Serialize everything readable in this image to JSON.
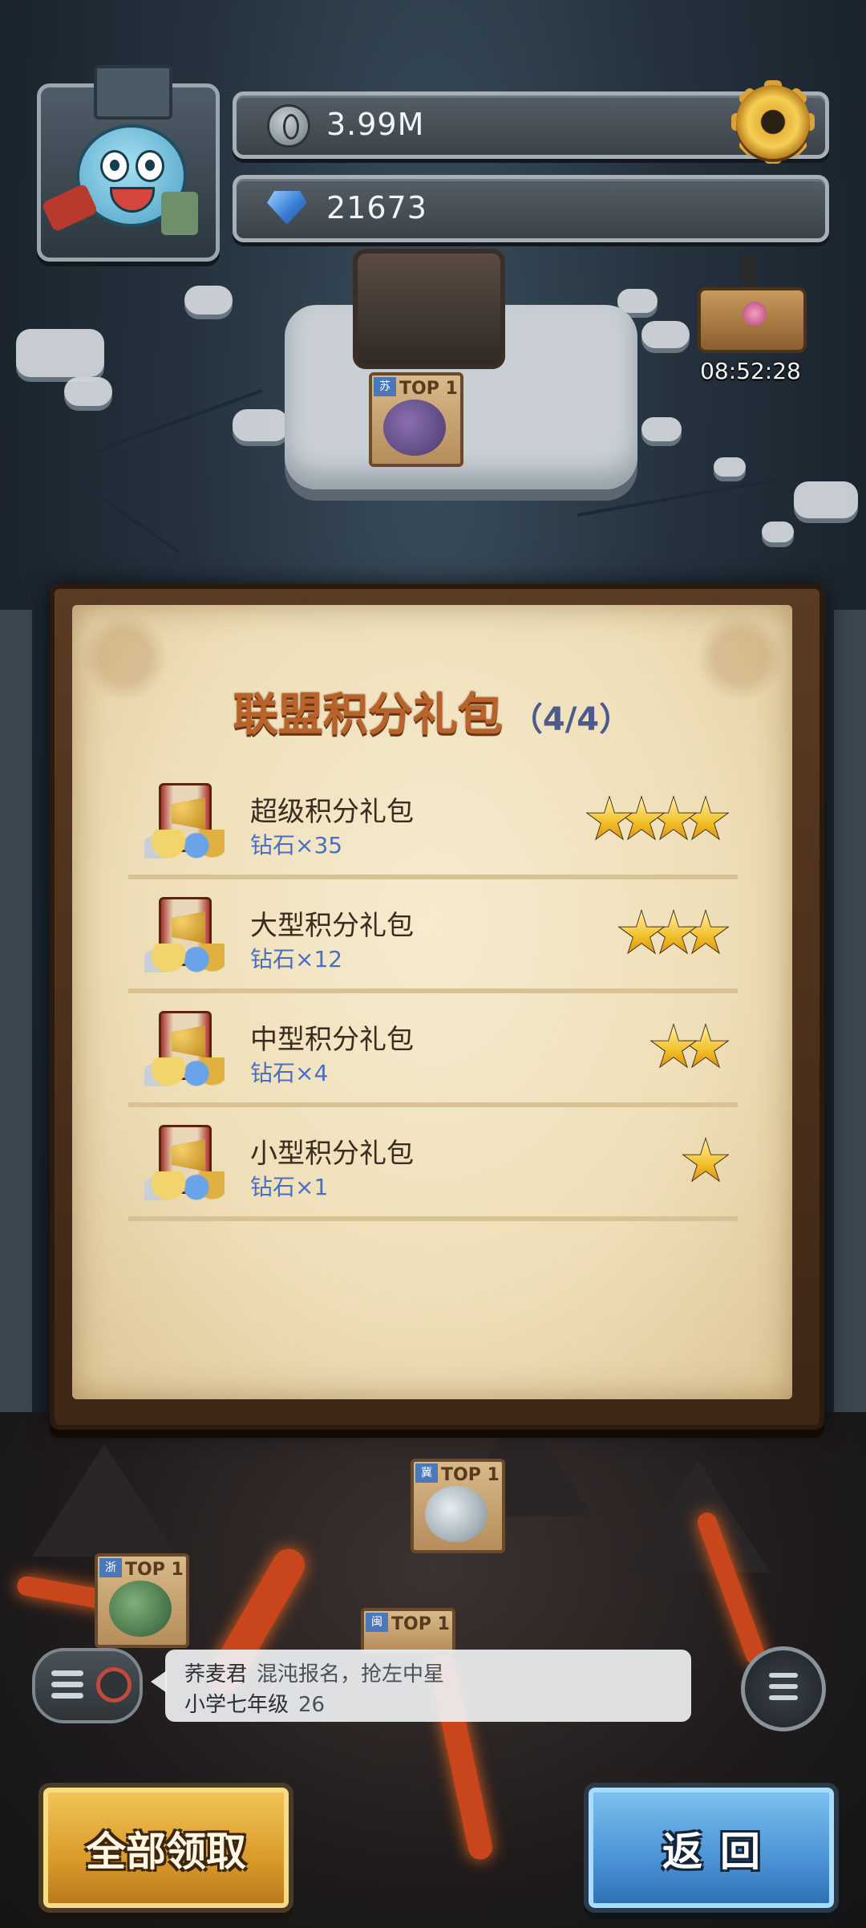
{
  "header": {
    "coins": "3.99M",
    "gems": "21673",
    "coin_icon": "silver-coin-icon",
    "gem_icon": "blue-gem-icon",
    "settings_icon": "gear-icon"
  },
  "map": {
    "chest_timer": "08:52:28",
    "badges": [
      {
        "label": "TOP 1",
        "province": "苏"
      },
      {
        "label": "TOP 1",
        "province": "冀"
      },
      {
        "label": "TOP 1",
        "province": "浙"
      },
      {
        "label": "TOP 1",
        "province": "闽"
      }
    ]
  },
  "panel": {
    "title": "联盟积分礼包",
    "count": "（4/4）",
    "packs": [
      {
        "name": "超级积分礼包",
        "reward": "钻石×35",
        "stars": 4
      },
      {
        "name": "大型积分礼包",
        "reward": "钻石×12",
        "stars": 3
      },
      {
        "name": "中型积分礼包",
        "reward": "钻石×4",
        "stars": 2
      },
      {
        "name": "小型积分礼包",
        "reward": "钻石×1",
        "stars": 1
      }
    ]
  },
  "chat": {
    "line1_user": "荞麦君",
    "line1_msg": "混沌报名，抢左中星",
    "line2_user": "小学七年级",
    "line2_msg": "26"
  },
  "buttons": {
    "claim_all": "全部领取",
    "back": "返回"
  },
  "colors": {
    "title": "#b9632b",
    "reward_text": "#4a6fc2",
    "claim_button": "#d99a2a",
    "back_button": "#4a93d6"
  }
}
